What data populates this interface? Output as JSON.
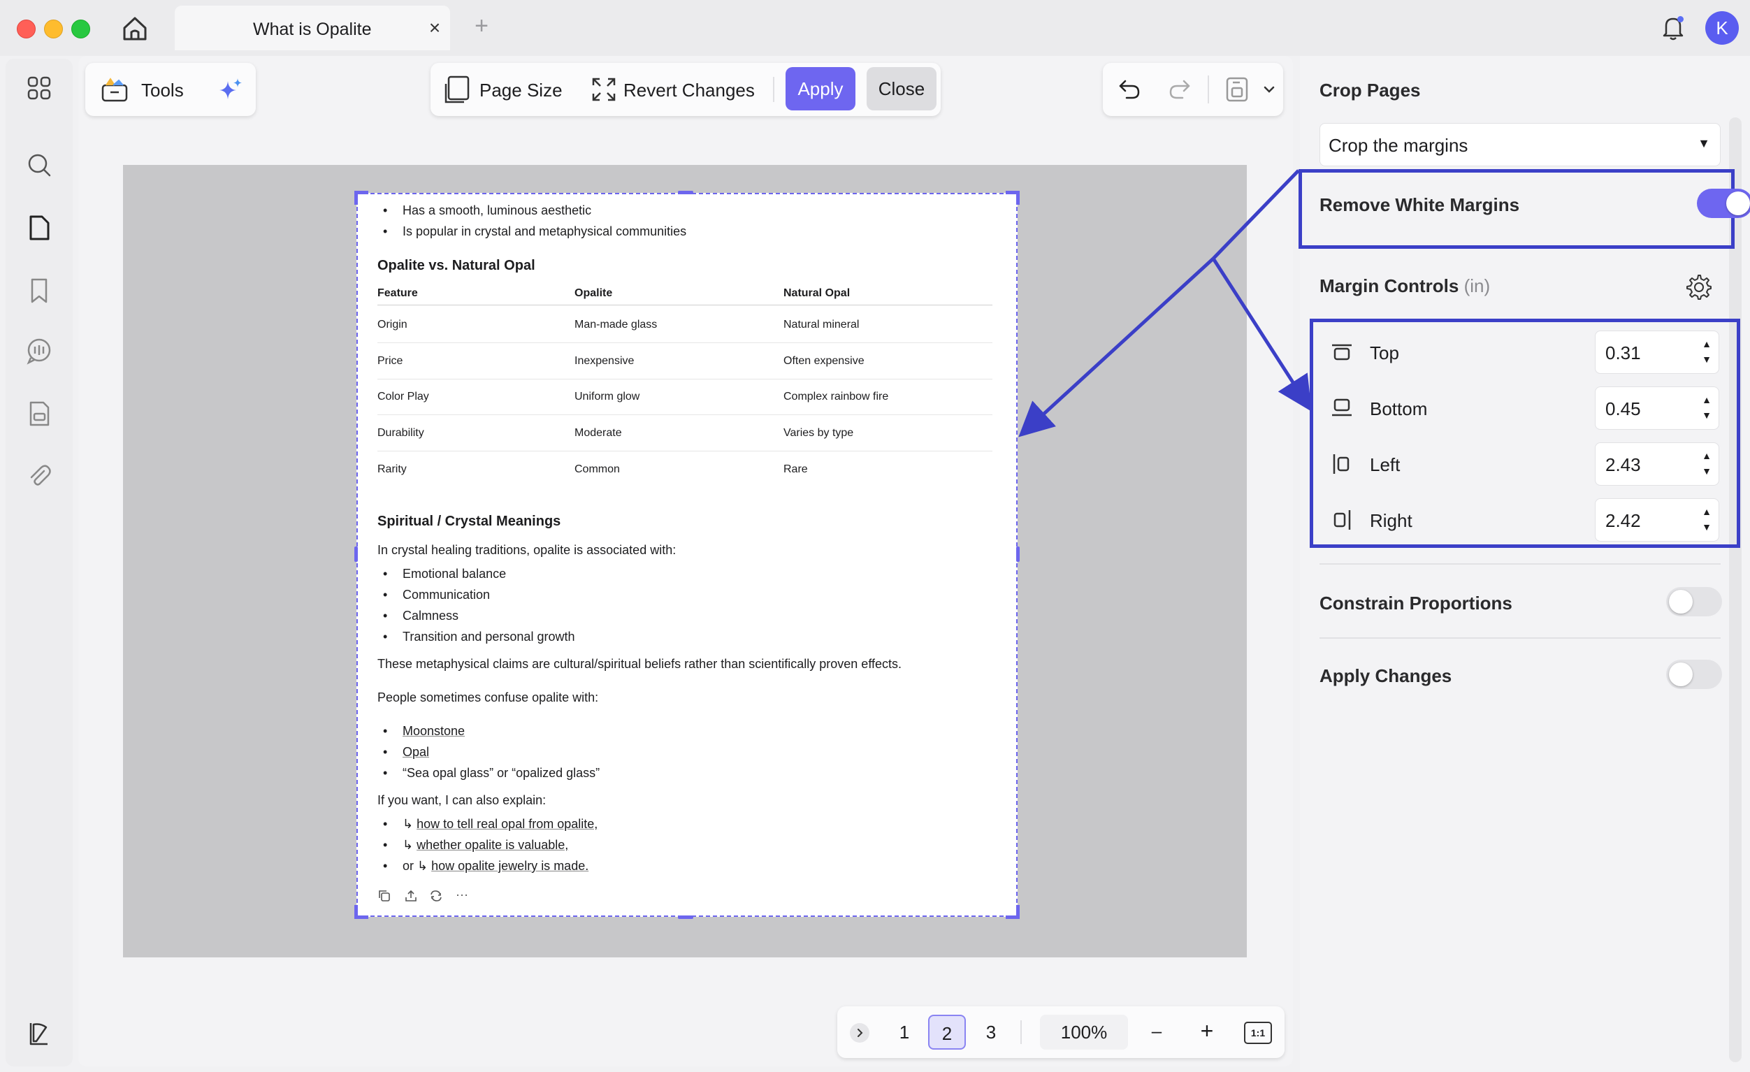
{
  "titlebar": {
    "tab_title": "What is Opalite",
    "avatar_initial": "K",
    "icons": [
      "home-icon",
      "close-icon",
      "plus-icon",
      "bell-icon"
    ]
  },
  "leftbar": {
    "icons": [
      "apps-grid-icon",
      "search-icon",
      "page-icon",
      "bookmark-icon",
      "comment-icon",
      "form-icon",
      "attachment-icon",
      "layers-icon"
    ]
  },
  "toolbar": {
    "tools_label": "Tools",
    "page_size_label": "Page Size",
    "revert_label": "Revert Changes",
    "apply_label": "Apply",
    "close_label": "Close"
  },
  "document": {
    "bullets_top": [
      "Has a smooth, luminous aesthetic",
      "Is popular in crystal and metaphysical communities"
    ],
    "comparison_heading": "Opalite vs. Natural Opal",
    "table_headers": [
      "Feature",
      "Opalite",
      "Natural Opal"
    ],
    "table_rows": [
      [
        "Origin",
        "Man-made glass",
        "Natural mineral"
      ],
      [
        "Price",
        "Inexpensive",
        "Often expensive"
      ],
      [
        "Color Play",
        "Uniform glow",
        "Complex rainbow fire"
      ],
      [
        "Durability",
        "Moderate",
        "Varies by type"
      ],
      [
        "Rarity",
        "Common",
        "Rare"
      ]
    ],
    "spiritual_heading": "Spiritual / Crystal Meanings",
    "spiritual_intro": "In crystal healing traditions, opalite is associated with:",
    "spiritual_bullets": [
      "Emotional balance",
      "Communication",
      "Calmness",
      "Transition and personal growth"
    ],
    "disclaimer": "These metaphysical claims are cultural/spiritual beliefs rather than scientifically proven effects.",
    "confuse_intro": "People sometimes confuse opalite with:",
    "confuse_bullets": [
      "Moonstone",
      "Opal",
      "“Sea opal glass” or “opalized glass”"
    ],
    "explain_intro": "If you want, I can also explain:",
    "explain_links": [
      {
        "prefix": "↳",
        "text": "how to tell real opal from opalite,"
      },
      {
        "prefix": "↳",
        "text": "whether opalite is valuable,"
      },
      {
        "prefix": "or ↳",
        "text": "how opalite jewelry is made."
      }
    ],
    "ellipsis": "···"
  },
  "pager": {
    "pages": [
      "1",
      "2",
      "3"
    ],
    "current_page": "2",
    "zoom": "100%",
    "zoom_out": "–",
    "zoom_in": "+",
    "actual_size": "1:1"
  },
  "panel": {
    "title": "Crop Pages",
    "mode_select": "Crop the margins",
    "remove_white_margins_label": "Remove White Margins",
    "remove_white_margins_on": true,
    "margin_controls_label": "Margin Controls",
    "margin_controls_unit": "(in)",
    "margins": [
      {
        "label": "Top",
        "value": "0.31"
      },
      {
        "label": "Bottom",
        "value": "0.45"
      },
      {
        "label": "Left",
        "value": "2.43"
      },
      {
        "label": "Right",
        "value": "2.42"
      }
    ],
    "constrain_label": "Constrain Proportions",
    "constrain_on": false,
    "apply_changes_label": "Apply Changes",
    "apply_changes_on": false
  },
  "colors": {
    "accent": "#6e66f0",
    "highlight_border": "#3b3fc7",
    "canvas_bg": "#c7c7c9"
  }
}
